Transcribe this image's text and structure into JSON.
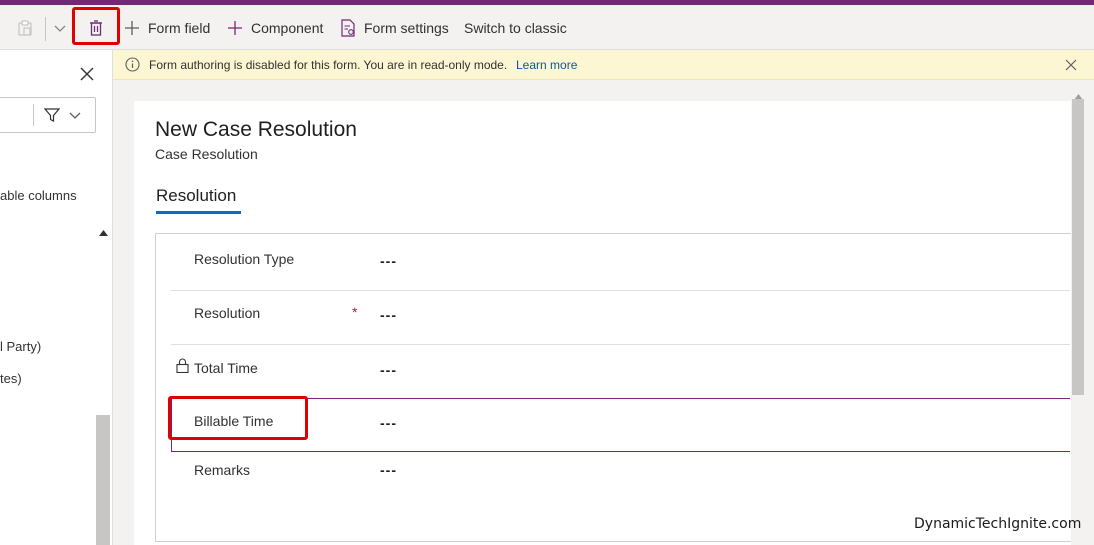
{
  "toolbar": {
    "form_field_label": "Form field",
    "component_label": "Component",
    "form_settings_label": "Form settings",
    "switch_classic_label": "Switch to classic"
  },
  "side_panel": {
    "text_billable_columns": "able columns",
    "text_party": "l Party)",
    "text_tes": "tes)"
  },
  "notice": {
    "message": "Form authoring is disabled for this form. You are in read-only mode.",
    "link_label": "Learn more"
  },
  "form": {
    "title": "New Case Resolution",
    "subtitle": "Case Resolution",
    "tab_label": "Resolution",
    "required_marker": "*",
    "fields": [
      {
        "label": "Resolution Type",
        "value": "---"
      },
      {
        "label": "Resolution",
        "value": "---"
      },
      {
        "label": "Total Time",
        "value": "---"
      },
      {
        "label": "Billable Time",
        "value": "---"
      },
      {
        "label": "Remarks",
        "value": "---"
      }
    ]
  },
  "watermark": "DynamicTechIgnite.com",
  "colors": {
    "brand": "#742774",
    "highlight": "#e00000",
    "notice_bg": "#fdf6d3",
    "link": "#005a9e",
    "tab_accent": "#0f6cbd",
    "required": "#a4262c"
  }
}
